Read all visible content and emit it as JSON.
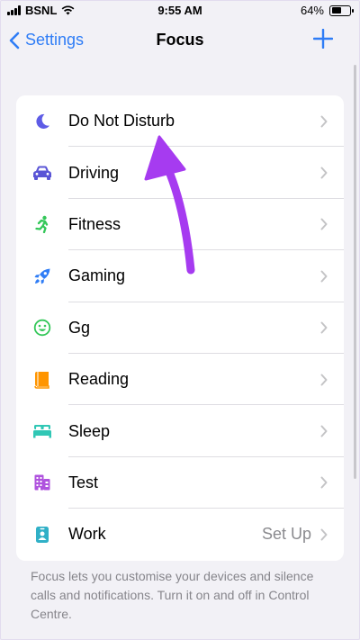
{
  "status_bar": {
    "carrier": "BSNL",
    "time": "9:55 AM",
    "battery_percent": "64%",
    "battery_level": 0.64
  },
  "nav": {
    "back_label": "Settings",
    "title": "Focus"
  },
  "focus_items": [
    {
      "label": "Do Not Disturb",
      "icon": "moon-icon",
      "color": "#5e5ce6",
      "detail": ""
    },
    {
      "label": "Driving",
      "icon": "car-icon",
      "color": "#5a55d6",
      "detail": ""
    },
    {
      "label": "Fitness",
      "icon": "running-figure-icon",
      "color": "#34c759",
      "detail": ""
    },
    {
      "label": "Gaming",
      "icon": "rocket-icon",
      "color": "#2f7df6",
      "detail": ""
    },
    {
      "label": "Gg",
      "icon": "smiley-icon",
      "color": "#34c759",
      "detail": ""
    },
    {
      "label": "Reading",
      "icon": "book-icon",
      "color": "#ff9500",
      "detail": ""
    },
    {
      "label": "Sleep",
      "icon": "bed-icon",
      "color": "#30c7b5",
      "detail": ""
    },
    {
      "label": "Test",
      "icon": "building-icon",
      "color": "#af52de",
      "detail": ""
    },
    {
      "label": "Work",
      "icon": "id-badge-icon",
      "color": "#30b0c7",
      "detail": "Set Up"
    }
  ],
  "footer_text": "Focus lets you customise your devices and silence calls and notifications. Turn it on and off in Control Centre.",
  "colors": {
    "accent": "#2f7df6",
    "annotation_arrow": "#a63bf0",
    "background": "#f2f1f6"
  }
}
